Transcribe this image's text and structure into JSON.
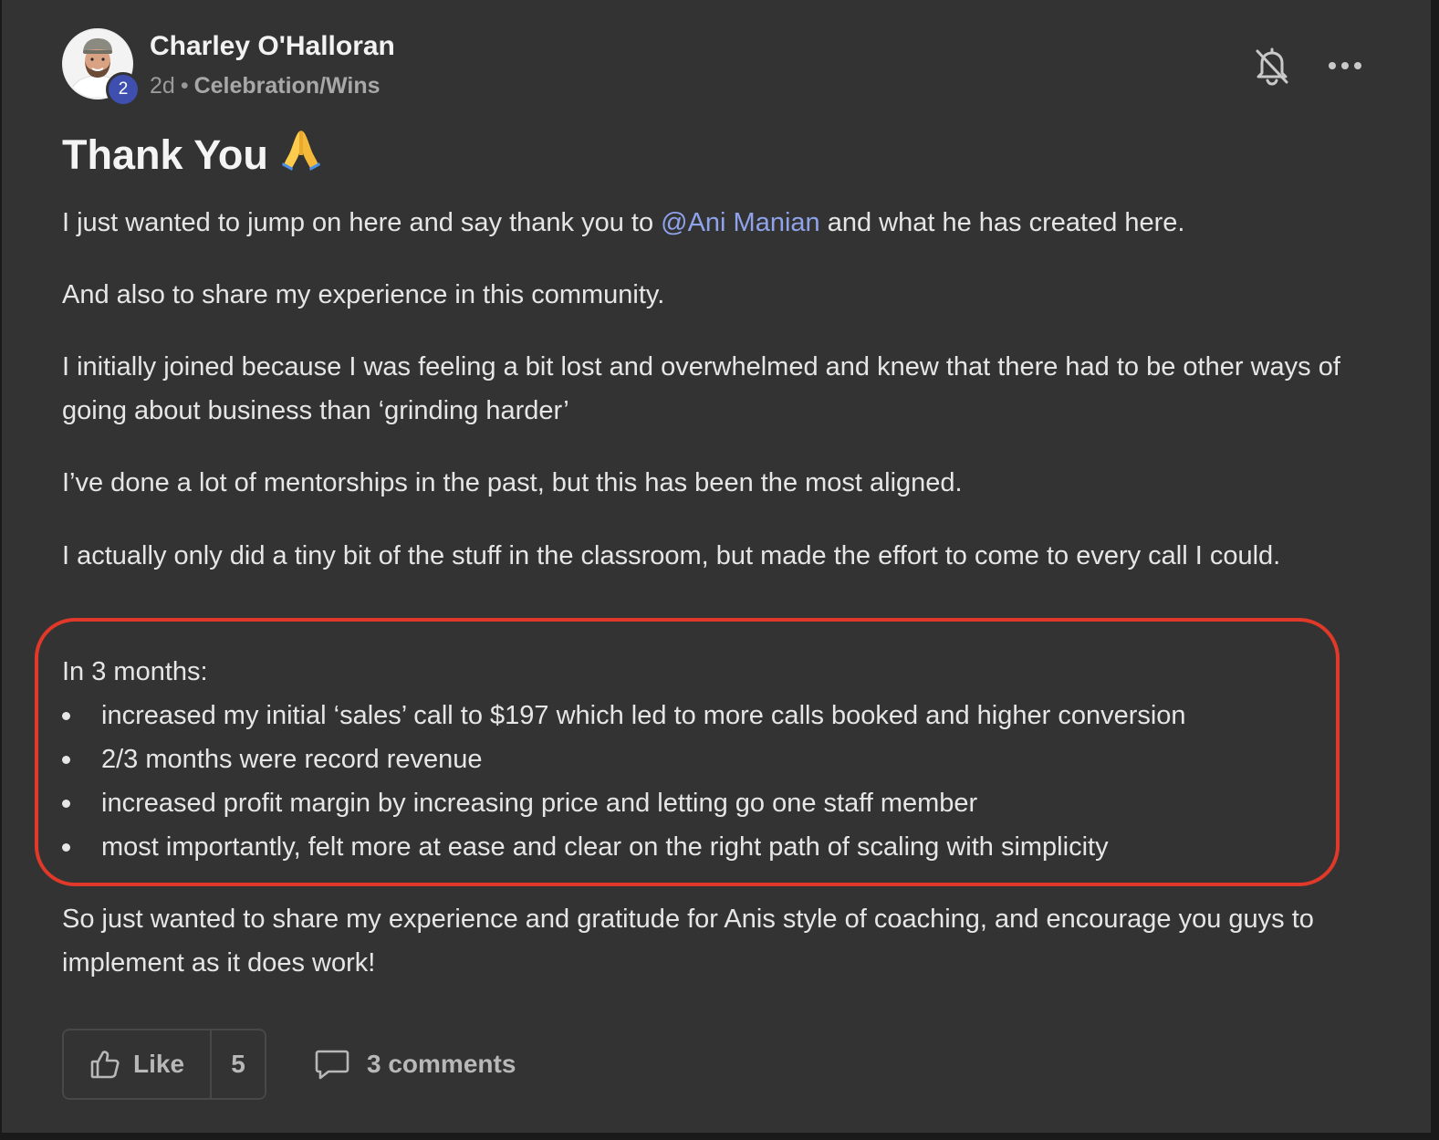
{
  "author": {
    "name": "Charley O'Halloran",
    "level": "2",
    "time": "2d",
    "separator": "•",
    "category": "Celebration/Wins"
  },
  "header_icons": [
    "bell-off-icon",
    "more-horizontal-icon"
  ],
  "post": {
    "title": "Thank You",
    "title_emoji": "folded-hands-emoji",
    "p1_before": "I just wanted to jump on here and say thank you to ",
    "mention": "@Ani Manian",
    "p1_after": " and what he has created here.",
    "p2": "And also to share my experience in this community.",
    "p3": "I initially joined because I was feeling a bit lost and overwhelmed and knew that there had to be other ways of going about business than ‘grinding harder’",
    "p4": "I’ve done a lot of mentorships in the past, but this has been the most aligned.",
    "p5": "I actually only did a tiny bit of the stuff in the classroom, but made the effort to come to every call I could.",
    "list_intro": "In 3 months:",
    "list_items": [
      "increased my initial ‘sales’ call to $197 which led to more calls booked and higher conversion",
      "2/3 months were record revenue",
      "increased profit margin by increasing price and letting go one staff member",
      "most importantly, felt more at ease and clear on the right path of scaling with simplicity"
    ],
    "p7": "So just wanted to share my experience and gratitude for Anis style of coaching, and encourage you guys to implement as it does work!"
  },
  "actions": {
    "like_label": "Like",
    "like_count": "5",
    "comments_label": "3 comments"
  },
  "colors": {
    "background": "#333333",
    "mention": "#8fa3ea",
    "highlight_outline": "#e0392a",
    "level_badge": "#3e4fb0"
  }
}
